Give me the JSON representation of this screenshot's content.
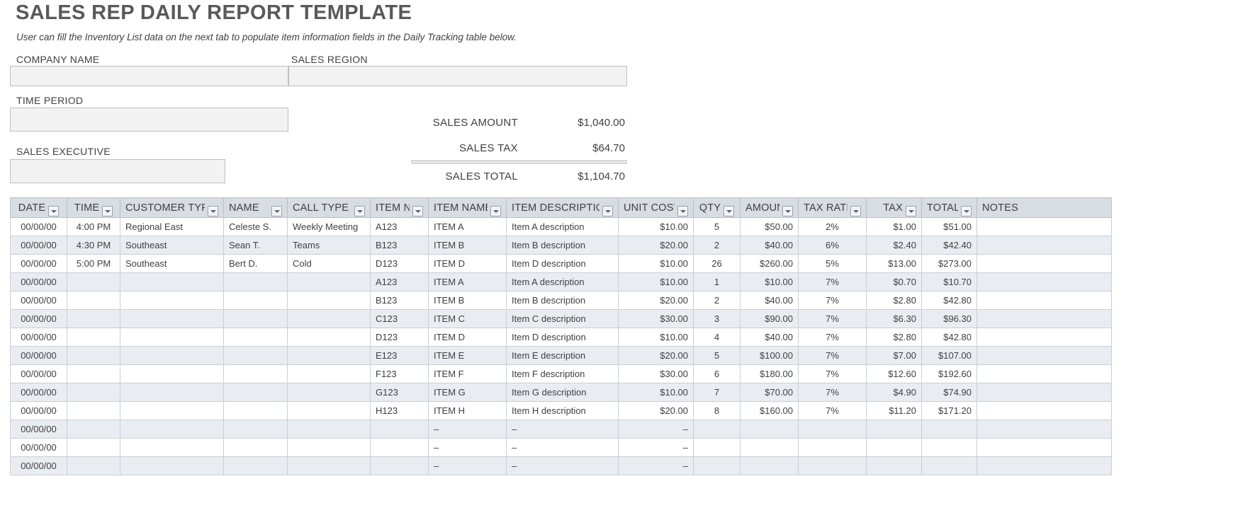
{
  "header": {
    "title": "SALES REP DAILY REPORT TEMPLATE",
    "subtitle": "User can fill the Inventory List data on the next tab to populate item information fields in the Daily Tracking table below."
  },
  "fields": {
    "company_name_label": "COMPANY NAME",
    "company_name_value": "",
    "sales_region_label": "SALES REGION",
    "sales_region_value": "",
    "time_period_label": "TIME PERIOD",
    "time_period_value": "",
    "sales_executive_label": "SALES EXECUTIVE",
    "sales_executive_value": ""
  },
  "summary": {
    "sales_amount_label": "SALES AMOUNT",
    "sales_amount_value": "$1,040.00",
    "sales_tax_label": "SALES TAX",
    "sales_tax_value": "$64.70",
    "sales_total_label": "SALES TOTAL",
    "sales_total_value": "$1,104.70"
  },
  "table": {
    "columns": [
      "DATE",
      "TIME",
      "CUSTOMER TYPE",
      "NAME",
      "CALL TYPE",
      "ITEM NO",
      "ITEM NAME",
      "ITEM DESCRIPTION",
      "UNIT COST",
      "QTY",
      "AMOUNT",
      "TAX RATE",
      "TAX",
      "TOTAL",
      "NOTES"
    ],
    "rows": [
      {
        "date": "00/00/00",
        "time": "4:00 PM",
        "customer_type": "Regional East",
        "name": "Celeste S.",
        "call_type": "Weekly Meeting",
        "item_no": "A123",
        "item_name": "ITEM A",
        "item_description": "Item A description",
        "unit_cost": "$10.00",
        "qty": "5",
        "amount": "$50.00",
        "tax_rate": "2%",
        "tax": "$1.00",
        "total": "$51.00",
        "notes": ""
      },
      {
        "date": "00/00/00",
        "time": "4:30 PM",
        "customer_type": "Southeast",
        "name": "Sean T.",
        "call_type": "Teams",
        "item_no": "B123",
        "item_name": "ITEM B",
        "item_description": "Item B description",
        "unit_cost": "$20.00",
        "qty": "2",
        "amount": "$40.00",
        "tax_rate": "6%",
        "tax": "$2.40",
        "total": "$42.40",
        "notes": ""
      },
      {
        "date": "00/00/00",
        "time": "5:00 PM",
        "customer_type": "Southeast",
        "name": "Bert D.",
        "call_type": "Cold",
        "item_no": "D123",
        "item_name": "ITEM D",
        "item_description": "Item D description",
        "unit_cost": "$10.00",
        "qty": "26",
        "amount": "$260.00",
        "tax_rate": "5%",
        "tax": "$13.00",
        "total": "$273.00",
        "notes": ""
      },
      {
        "date": "00/00/00",
        "time": "",
        "customer_type": "",
        "name": "",
        "call_type": "",
        "item_no": "A123",
        "item_name": "ITEM A",
        "item_description": "Item A description",
        "unit_cost": "$10.00",
        "qty": "1",
        "amount": "$10.00",
        "tax_rate": "7%",
        "tax": "$0.70",
        "total": "$10.70",
        "notes": ""
      },
      {
        "date": "00/00/00",
        "time": "",
        "customer_type": "",
        "name": "",
        "call_type": "",
        "item_no": "B123",
        "item_name": "ITEM B",
        "item_description": "Item B description",
        "unit_cost": "$20.00",
        "qty": "2",
        "amount": "$40.00",
        "tax_rate": "7%",
        "tax": "$2.80",
        "total": "$42.80",
        "notes": ""
      },
      {
        "date": "00/00/00",
        "time": "",
        "customer_type": "",
        "name": "",
        "call_type": "",
        "item_no": "C123",
        "item_name": "ITEM C",
        "item_description": "Item C description",
        "unit_cost": "$30.00",
        "qty": "3",
        "amount": "$90.00",
        "tax_rate": "7%",
        "tax": "$6.30",
        "total": "$96.30",
        "notes": ""
      },
      {
        "date": "00/00/00",
        "time": "",
        "customer_type": "",
        "name": "",
        "call_type": "",
        "item_no": "D123",
        "item_name": "ITEM D",
        "item_description": "Item D description",
        "unit_cost": "$10.00",
        "qty": "4",
        "amount": "$40.00",
        "tax_rate": "7%",
        "tax": "$2.80",
        "total": "$42.80",
        "notes": ""
      },
      {
        "date": "00/00/00",
        "time": "",
        "customer_type": "",
        "name": "",
        "call_type": "",
        "item_no": "E123",
        "item_name": "ITEM E",
        "item_description": "Item E description",
        "unit_cost": "$20.00",
        "qty": "5",
        "amount": "$100.00",
        "tax_rate": "7%",
        "tax": "$7.00",
        "total": "$107.00",
        "notes": ""
      },
      {
        "date": "00/00/00",
        "time": "",
        "customer_type": "",
        "name": "",
        "call_type": "",
        "item_no": "F123",
        "item_name": "ITEM F",
        "item_description": "Item F description",
        "unit_cost": "$30.00",
        "qty": "6",
        "amount": "$180.00",
        "tax_rate": "7%",
        "tax": "$12.60",
        "total": "$192.60",
        "notes": ""
      },
      {
        "date": "00/00/00",
        "time": "",
        "customer_type": "",
        "name": "",
        "call_type": "",
        "item_no": "G123",
        "item_name": "ITEM G",
        "item_description": "Item G description",
        "unit_cost": "$10.00",
        "qty": "7",
        "amount": "$70.00",
        "tax_rate": "7%",
        "tax": "$4.90",
        "total": "$74.90",
        "notes": ""
      },
      {
        "date": "00/00/00",
        "time": "",
        "customer_type": "",
        "name": "",
        "call_type": "",
        "item_no": "H123",
        "item_name": "ITEM H",
        "item_description": "Item H description",
        "unit_cost": "$20.00",
        "qty": "8",
        "amount": "$160.00",
        "tax_rate": "7%",
        "tax": "$11.20",
        "total": "$171.20",
        "notes": ""
      },
      {
        "date": "00/00/00",
        "time": "",
        "customer_type": "",
        "name": "",
        "call_type": "",
        "item_no": "",
        "item_name": "–",
        "item_description": "–",
        "unit_cost": "–",
        "qty": "",
        "amount": "",
        "tax_rate": "",
        "tax": "",
        "total": "",
        "notes": ""
      },
      {
        "date": "00/00/00",
        "time": "",
        "customer_type": "",
        "name": "",
        "call_type": "",
        "item_no": "",
        "item_name": "–",
        "item_description": "–",
        "unit_cost": "–",
        "qty": "",
        "amount": "",
        "tax_rate": "",
        "tax": "",
        "total": "",
        "notes": ""
      },
      {
        "date": "00/00/00",
        "time": "",
        "customer_type": "",
        "name": "",
        "call_type": "",
        "item_no": "",
        "item_name": "–",
        "item_description": "–",
        "unit_cost": "–",
        "qty": "",
        "amount": "",
        "tax_rate": "",
        "tax": "",
        "total": "",
        "notes": ""
      }
    ]
  },
  "colors": {
    "header_fill": "#d8dce3",
    "stripe_fill": "#e9edf2",
    "input_fill": "#f2f2f2",
    "title_text": "#595959"
  }
}
